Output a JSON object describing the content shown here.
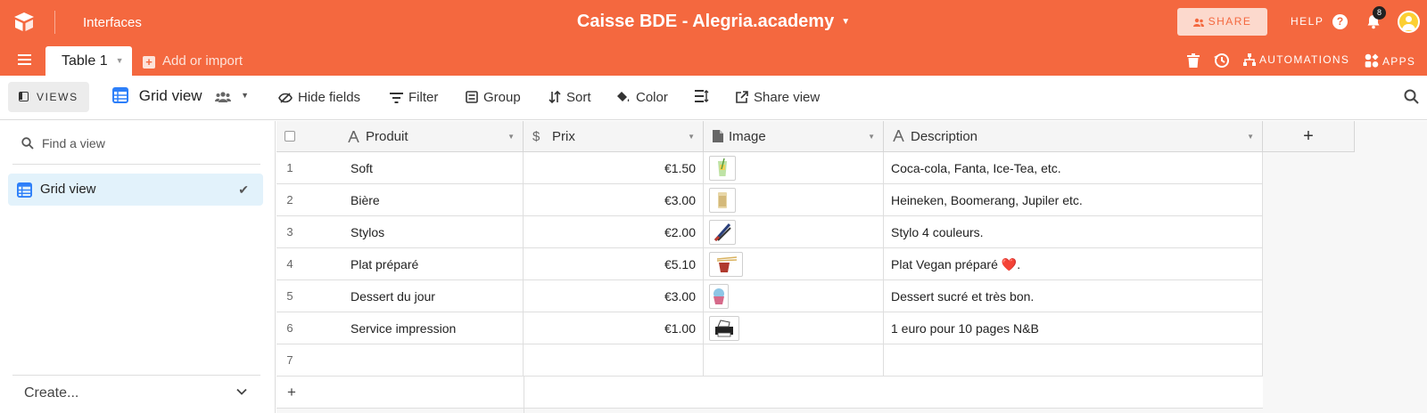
{
  "header": {
    "interfaces_label": "Interfaces",
    "base_title": "Caisse BDE - Alegria.academy",
    "share_label": "SHARE",
    "help_label": "HELP",
    "notification_count": "8",
    "automations_label": "AUTOMATIONS",
    "apps_label": "APPS",
    "accent_color": "#f4683f"
  },
  "tabs": {
    "active_table": "Table 1",
    "add_or_import": "Add or import"
  },
  "toolbar": {
    "views_label": "VIEWS",
    "current_view": "Grid view",
    "hide_fields": "Hide fields",
    "filter": "Filter",
    "group": "Group",
    "sort": "Sort",
    "color": "Color",
    "share_view": "Share view"
  },
  "sidebar": {
    "find_placeholder": "Find a view",
    "views": [
      {
        "label": "Grid view",
        "selected": true
      }
    ],
    "create_label": "Create..."
  },
  "grid": {
    "columns": [
      {
        "label": "Produit",
        "type_icon": "text-icon"
      },
      {
        "label": "Prix",
        "type_icon": "currency-icon"
      },
      {
        "label": "Image",
        "type_icon": "attachment-icon"
      },
      {
        "label": "Description",
        "type_icon": "text-icon"
      }
    ],
    "rows": [
      {
        "num": "1",
        "produit": "Soft",
        "prix": "€1.50",
        "image": "soft-drink-thumbnail",
        "description": "Coca-cola, Fanta, Ice-Tea, etc."
      },
      {
        "num": "2",
        "produit": "Bière",
        "prix": "€3.00",
        "image": "beer-thumbnail",
        "description": "Heineken, Boomerang, Jupiler etc."
      },
      {
        "num": "3",
        "produit": "Stylos",
        "prix": "€2.00",
        "image": "pens-thumbnail",
        "description": "Stylo 4 couleurs."
      },
      {
        "num": "4",
        "produit": "Plat préparé",
        "prix": "€5.10",
        "image": "noodles-thumbnail",
        "description": "Plat Vegan préparé ❤️."
      },
      {
        "num": "5",
        "produit": "Dessert du jour",
        "prix": "€3.00",
        "image": "cupcake-thumbnail",
        "description": "Dessert sucré et très bon."
      },
      {
        "num": "6",
        "produit": "Service impression",
        "prix": "€1.00",
        "image": "printer-thumbnail",
        "description": "1 euro pour 10 pages N&B"
      },
      {
        "num": "7",
        "produit": "",
        "prix": "",
        "image": "",
        "description": ""
      }
    ],
    "add_field_label": "+",
    "add_row_label": "+"
  }
}
